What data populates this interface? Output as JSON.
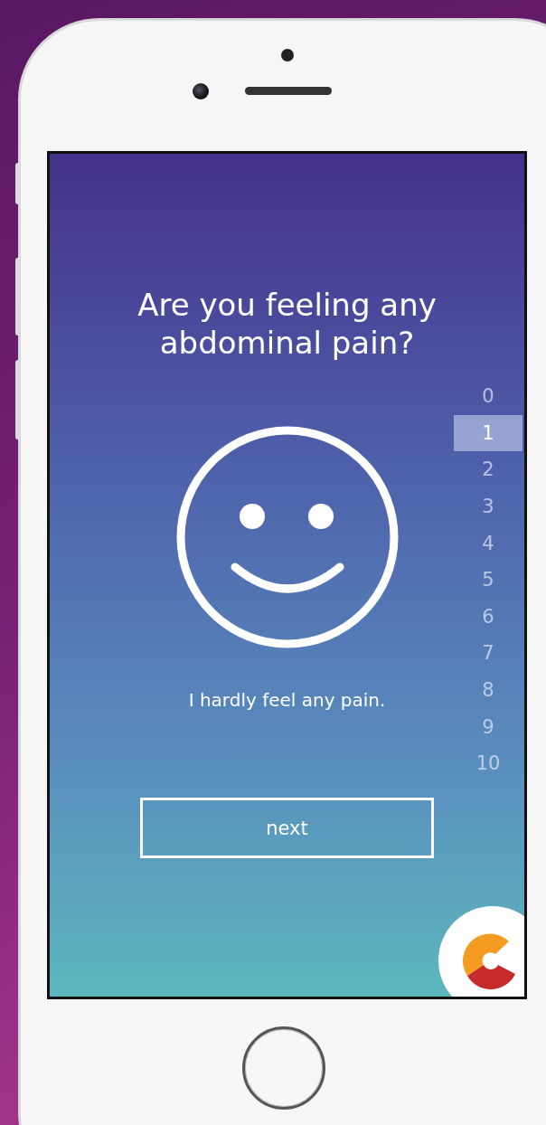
{
  "question": "Are you feeling any abdominal pain?",
  "caption": "I hardly feel any pain.",
  "next_button": "next",
  "scale": [
    {
      "label": "0",
      "selected": false
    },
    {
      "label": "1",
      "selected": true
    },
    {
      "label": "2",
      "selected": false
    },
    {
      "label": "3",
      "selected": false
    },
    {
      "label": "4",
      "selected": false
    },
    {
      "label": "5",
      "selected": false
    },
    {
      "label": "6",
      "selected": false
    },
    {
      "label": "7",
      "selected": false
    },
    {
      "label": "8",
      "selected": false
    },
    {
      "label": "9",
      "selected": false
    },
    {
      "label": "10",
      "selected": false
    }
  ]
}
